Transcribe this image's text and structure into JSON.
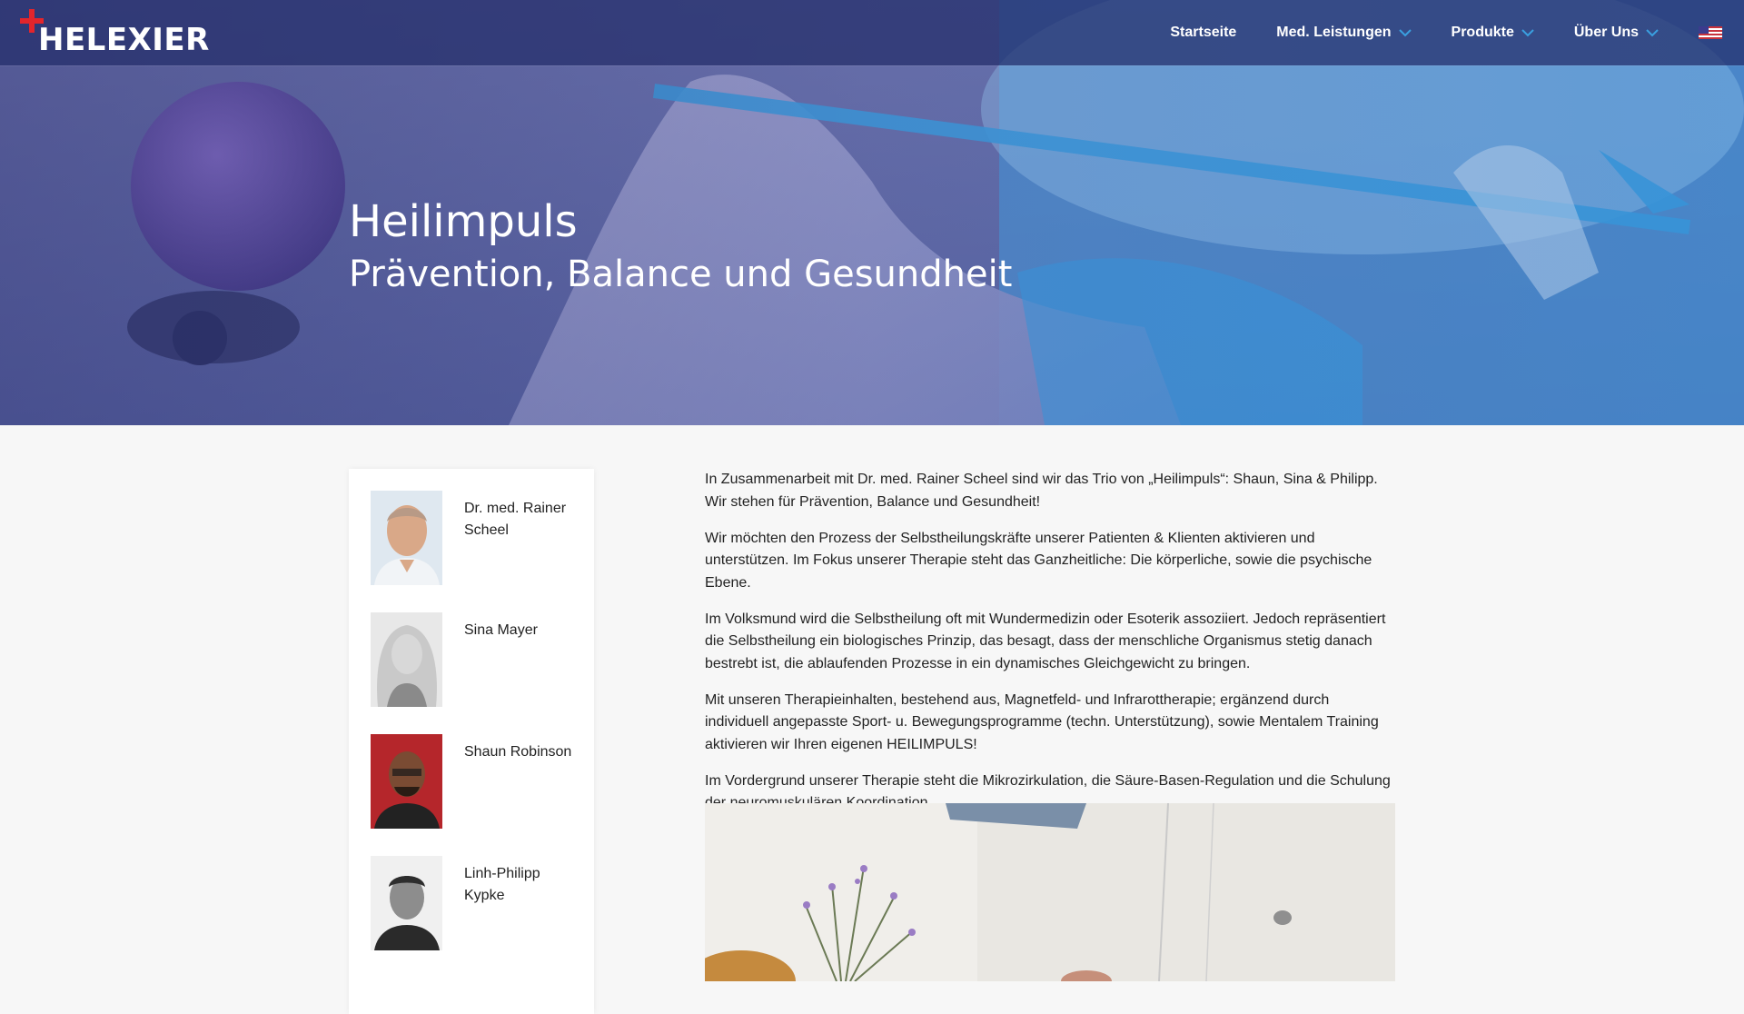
{
  "brand": {
    "logo_text": "HELEXIER",
    "accent_red": "#e3252c",
    "accent_blue": "#3aa0e0"
  },
  "nav": {
    "items": [
      {
        "label": "Startseite",
        "dropdown": false
      },
      {
        "label": "Med. Leistungen",
        "dropdown": true
      },
      {
        "label": "Produkte",
        "dropdown": true
      },
      {
        "label": "Über Uns",
        "dropdown": true
      }
    ],
    "language_icon": "us-flag-icon"
  },
  "hero": {
    "title": "Heilimpuls",
    "subtitle": "Prävention, Balance und Gesundheit"
  },
  "team": [
    {
      "name": "Dr. med. Rainer Scheel"
    },
    {
      "name": "Sina Mayer"
    },
    {
      "name": "Shaun Robinson"
    },
    {
      "name": "Linh-Philipp Kypke"
    }
  ],
  "content": {
    "paragraphs": [
      "In Zusammenarbeit mit Dr. med. Rainer Scheel sind wir das Trio von „Heilimpuls“: Shaun, Sina & Philipp. Wir stehen für Prävention, Balance und Gesundheit!",
      "Wir möchten den Prozess der Selbstheilungskräfte unserer Patienten & Klienten aktivieren und unterstützen. Im Fokus unserer Therapie steht das Ganzheitliche: Die körperliche, sowie die psychische Ebene.",
      "Im Volksmund wird die Selbstheilung oft mit Wundermedizin oder Esoterik assoziiert. Jedoch repräsentiert die Selbstheilung ein biologisches Prinzip, das besagt, dass der menschliche Organismus stetig danach bestrebt ist, die ablaufenden Prozesse in ein dynamisches Gleichgewicht zu bringen.",
      "Mit unseren Therapieinhalten, bestehend aus, Magnetfeld- und Infrarottherapie; ergänzend durch individuell angepasste Sport- u. Bewegungsprogramme (techn. Unterstützung), sowie Mentalem Training aktivieren wir Ihren eigenen HEILIMPULS!",
      "Im Vordergrund unserer Therapie steht die Mikrozirkulation, die Säure-Basen-Regulation und die Schulung der neuromuskulären Koordination."
    ]
  }
}
